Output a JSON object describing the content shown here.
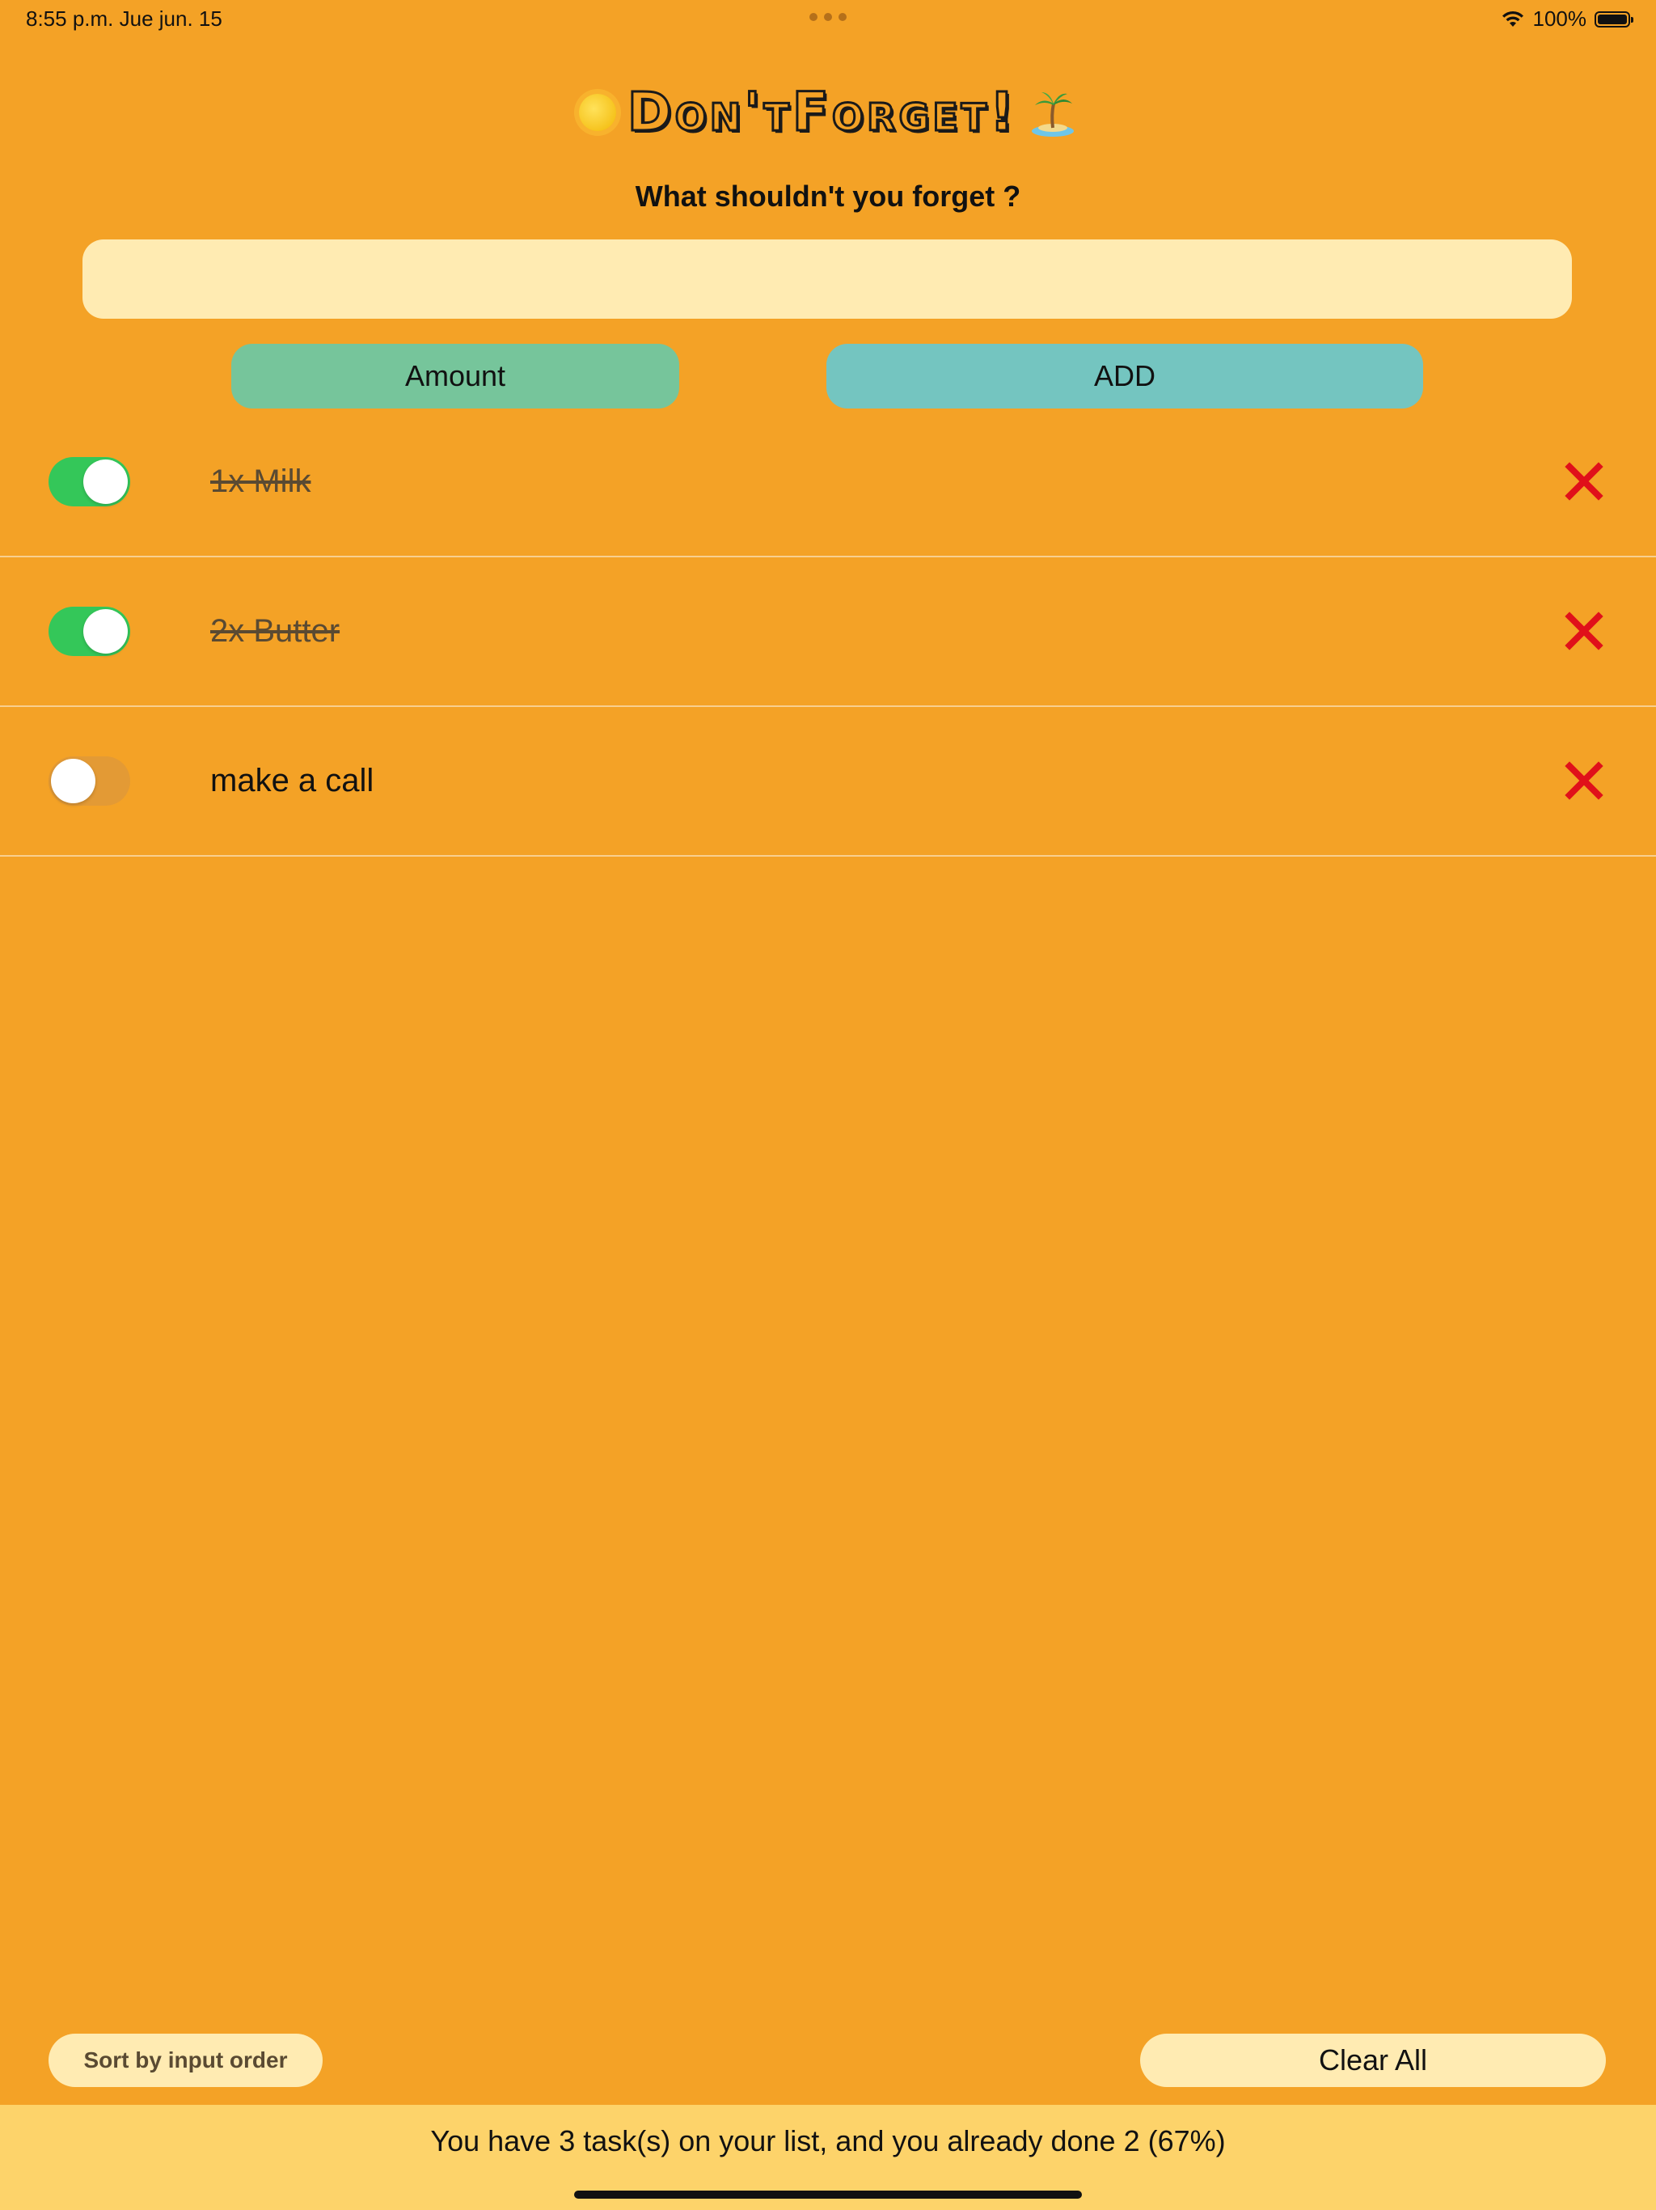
{
  "status_bar": {
    "time": "8:55 p.m.   Jue jun. 15",
    "battery_percent": "100%"
  },
  "header": {
    "title": "Don'tForget!",
    "subtitle": "What shouldn't you forget ?"
  },
  "input": {
    "value": "",
    "placeholder": ""
  },
  "buttons": {
    "amount_label": "Amount",
    "add_label": "ADD"
  },
  "tasks": [
    {
      "label": "1x  Milk",
      "done": true
    },
    {
      "label": "2x  Butter",
      "done": true
    },
    {
      "label": "make a call",
      "done": false
    }
  ],
  "footer": {
    "sort_label": "Sort by input order",
    "clear_label": "Clear All",
    "summary": "You have 3 task(s) on your list, and you already done 2 (67%)"
  },
  "colors": {
    "background": "#f4a226",
    "toggle_on": "#34c759",
    "delete": "#e0101a",
    "input_bg": "#ffebb2",
    "summary_bg": "#fdd36a"
  }
}
